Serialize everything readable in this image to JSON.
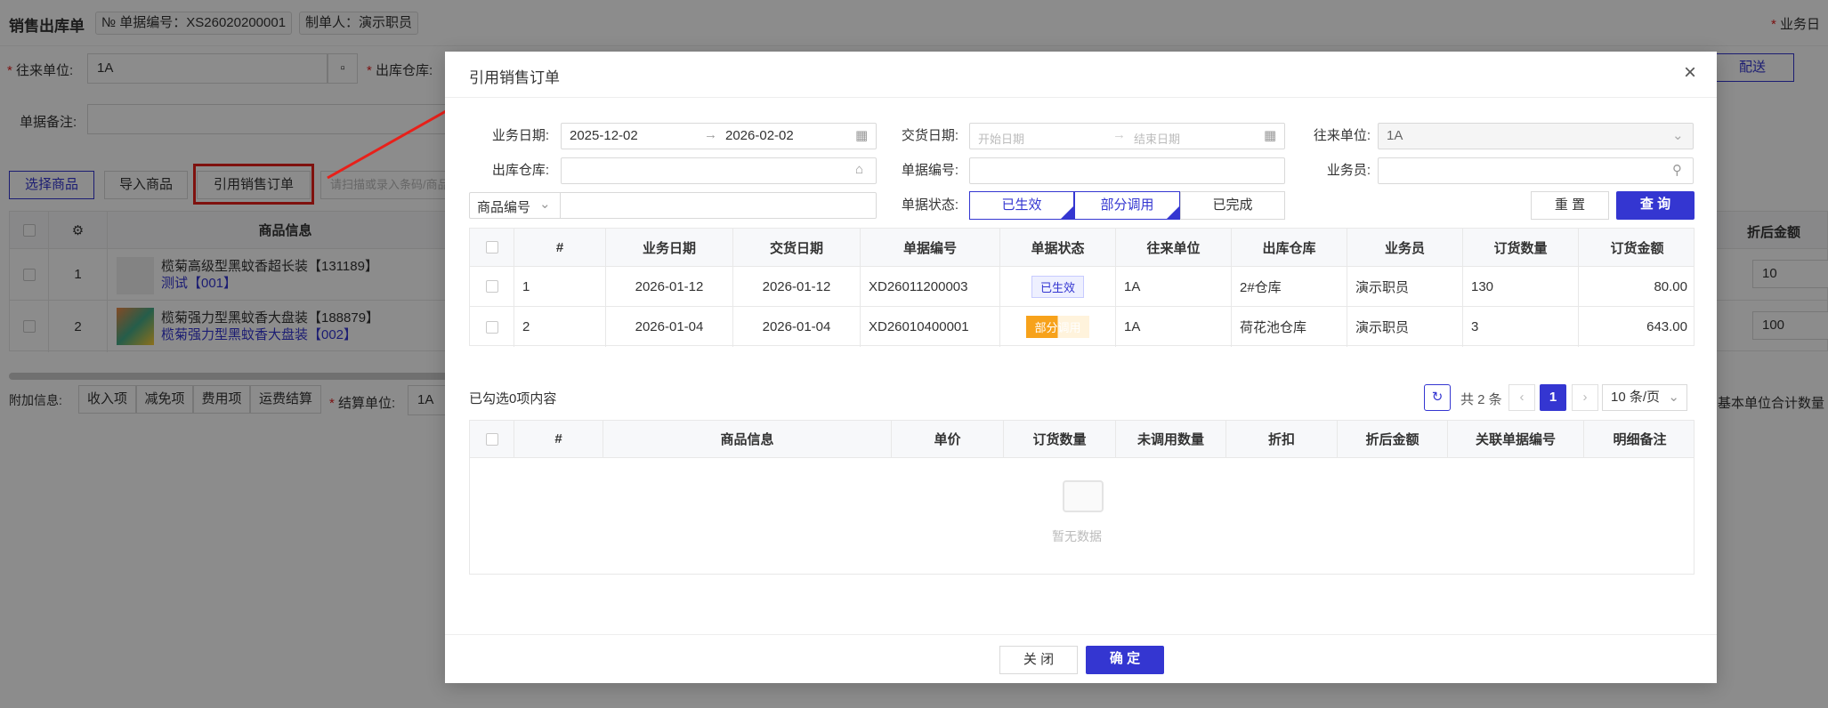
{
  "background": {
    "page_title": "销售出库单",
    "doc_no": "№ 单据编号：XS26020200001",
    "maker": "制单人：演示职员",
    "top_right_label": "业务日",
    "partner_label": "往来单位:",
    "partner_value": "1A",
    "warehouse_label": "出库仓库:",
    "delivery_btn": "配送",
    "remark_label": "单据备注:",
    "btn_select_goods": "选择商品",
    "btn_import_goods": "导入商品",
    "btn_ref_order": "引用销售订单",
    "scan_placeholder": "请扫描或录入条码/商品",
    "table_header_goods": "商品信息",
    "table_header_discount_amount": "折后金额",
    "rows": [
      {
        "idx": "1",
        "name": "榄菊高级型黑蚊香超长装【131189】",
        "sub": "测试【001】",
        "amount": "10"
      },
      {
        "idx": "2",
        "name": "榄菊强力型黑蚊香大盘装【188879】",
        "sub": "榄菊强力型黑蚊香大盘装【002】",
        "amount": "100"
      }
    ],
    "extra_label": "附加信息:",
    "extra_tabs": [
      "收入项",
      "减免项",
      "费用项",
      "运费结算"
    ],
    "settle_label": "结算单位:",
    "settle_value": "1A",
    "bottom_right": "基本单位合计数量"
  },
  "modal": {
    "title": "引用销售订单",
    "filters": {
      "biz_date_label": "业务日期:",
      "biz_date_start": "2025-12-02",
      "biz_date_end": "2026-02-02",
      "delivery_date_label": "交货日期:",
      "delivery_start_ph": "开始日期",
      "delivery_end_ph": "结束日期",
      "partner_label": "往来单位:",
      "partner_value": "1A",
      "warehouse_label": "出库仓库:",
      "doc_no_label": "单据编号:",
      "salesman_label": "业务员:",
      "goods_code_select": "商品编号",
      "status_label": "单据状态:",
      "status_options": [
        "已生效",
        "部分调用",
        "已完成"
      ],
      "btn_reset": "重 置",
      "btn_query": "查 询"
    },
    "order_table": {
      "headers": [
        "#",
        "业务日期",
        "交货日期",
        "单据编号",
        "单据状态",
        "往来单位",
        "出库仓库",
        "业务员",
        "订货数量",
        "订货金额"
      ],
      "rows": [
        {
          "idx": "1",
          "biz_date": "2026-01-12",
          "delivery_date": "2026-01-12",
          "doc_no": "XD26011200003",
          "status": "已生效",
          "partner": "1A",
          "warehouse": "2#仓库",
          "salesman": "演示职员",
          "qty": "130",
          "amount": "80.00"
        },
        {
          "idx": "2",
          "biz_date": "2026-01-04",
          "delivery_date": "2026-01-04",
          "doc_no": "XD26010400001",
          "status": "部分调用",
          "partner": "1A",
          "warehouse": "荷花池仓库",
          "salesman": "演示职员",
          "qty": "3",
          "amount": "643.00"
        }
      ]
    },
    "selected_info": "已勾选0项内容",
    "pager": {
      "total": "共 2 条",
      "current": "1",
      "page_size": "10 条/页"
    },
    "detail_table": {
      "headers": [
        "#",
        "商品信息",
        "单价",
        "订货数量",
        "未调用数量",
        "折扣",
        "折后金额",
        "关联单据编号",
        "明细备注"
      ],
      "empty_text": "暂无数据"
    },
    "btn_close": "关 闭",
    "btn_confirm": "确 定"
  },
  "colors": {
    "primary": "#3436d1",
    "status_active_bg": "#eef0ff",
    "status_partial": "#f7a21b",
    "annotation": "#e8201a"
  }
}
